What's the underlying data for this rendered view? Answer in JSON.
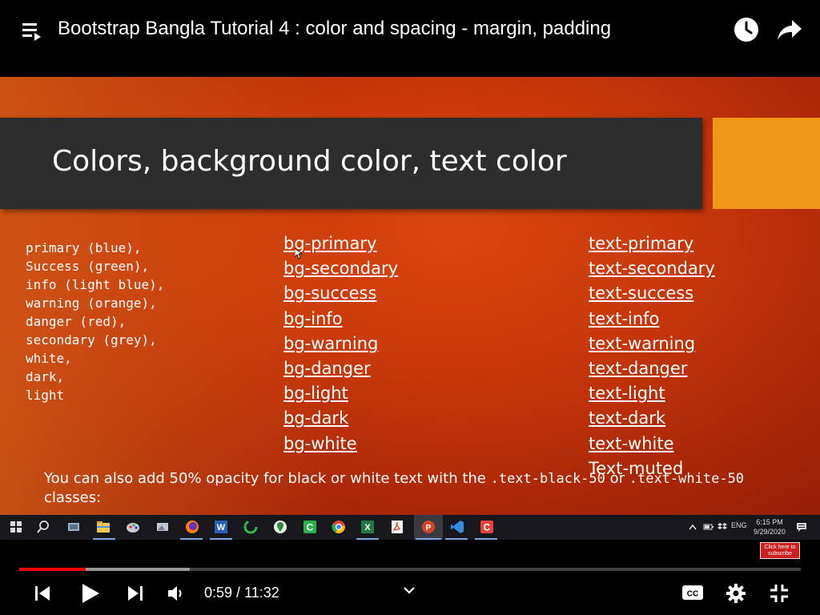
{
  "header": {
    "title": "Bootstrap Bangla Tutorial 4 : color and spacing - margin, padding",
    "icons": [
      "playlist-icon",
      "watch-later-icon",
      "share-icon"
    ]
  },
  "slide": {
    "title": "Colors, background color, text color",
    "colors": [
      "primary (blue),",
      "Success (green),",
      "info (light blue),",
      "warning (orange),",
      "danger (red),",
      "secondary (grey),",
      "white,",
      "dark,",
      "light"
    ],
    "bg_classes": [
      "bg-primary",
      "bg-secondary",
      "bg-success",
      "bg-info",
      "bg-warning",
      "bg-danger",
      "bg-light",
      "bg-dark",
      "bg-white"
    ],
    "text_classes": [
      "text-primary",
      "text-secondary",
      "text-success",
      "text-info",
      "text-warning",
      "text-danger",
      "text-light",
      "text-dark",
      "text-white"
    ],
    "text_muted": "Text-muted",
    "note": {
      "before": "You can also add 50% opacity for black or white text with the ",
      "code1": ".text-black-50",
      "middle": " or ",
      "code2": ".text-white-50",
      "after": " classes:"
    },
    "colors_palette": {
      "band": "#2d2d2d",
      "accent": "#f0961a",
      "background": "#c8380a"
    }
  },
  "taskbar": {
    "apps": [
      "windows-start",
      "search",
      "task-view",
      "file-explorer",
      "paint",
      "photos",
      "firefox",
      "word",
      "loader",
      "maps",
      "camtasia",
      "chrome",
      "excel",
      "acrobat",
      "powerpoint",
      "vscode",
      "camtasia-recorder"
    ],
    "language": "ENG",
    "time": "6:15 PM",
    "date": "9/29/2020"
  },
  "player": {
    "current_time": "0:59",
    "separator": " / ",
    "duration": "11:32",
    "played_fraction": 0.085,
    "buffered_fraction": 0.218,
    "subscribe_label": "Click here to subscribe",
    "accent_color": "#ff0000"
  }
}
